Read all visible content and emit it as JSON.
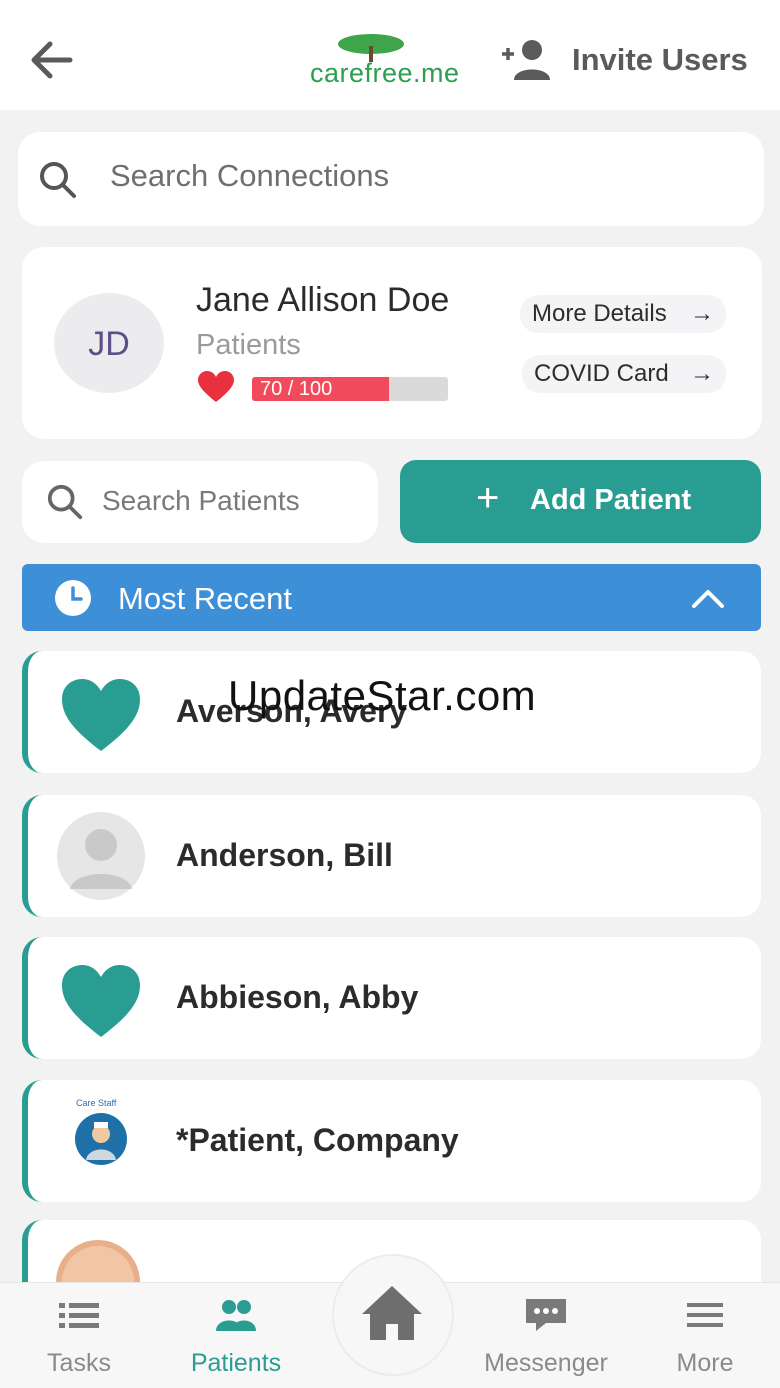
{
  "header": {
    "logo_text": "carefree.me",
    "invite_label": "Invite Users"
  },
  "search_connections": {
    "placeholder": "Search Connections"
  },
  "profile": {
    "initials": "JD",
    "name": "Jane Allison Doe",
    "role": "Patients",
    "health_score_text": "70 / 100",
    "health_score_fraction": 0.7,
    "more_details_label": "More Details",
    "covid_card_label": "COVID Card"
  },
  "search_patients": {
    "placeholder": "Search Patients"
  },
  "add_patient": {
    "label": "Add Patient"
  },
  "most_recent": {
    "label": "Most Recent"
  },
  "patients": [
    {
      "name": "Averson, Avery",
      "icon": "heart-icon"
    },
    {
      "name": "Anderson, Bill",
      "icon": "default-avatar"
    },
    {
      "name": "Abbieson, Abby",
      "icon": "heart-icon"
    },
    {
      "name": "*Patient, Company",
      "icon": "care-staff-avatar",
      "badge_text": "Care Staff"
    }
  ],
  "watermark": "UpdateStar.com",
  "bottom_nav": {
    "tasks": "Tasks",
    "patients": "Patients",
    "messenger": "Messenger",
    "more": "More"
  },
  "colors": {
    "teal": "#2a9d93",
    "blue": "#3d8fd8",
    "red": "#f04a5c",
    "logo_green": "#2e9e51"
  }
}
